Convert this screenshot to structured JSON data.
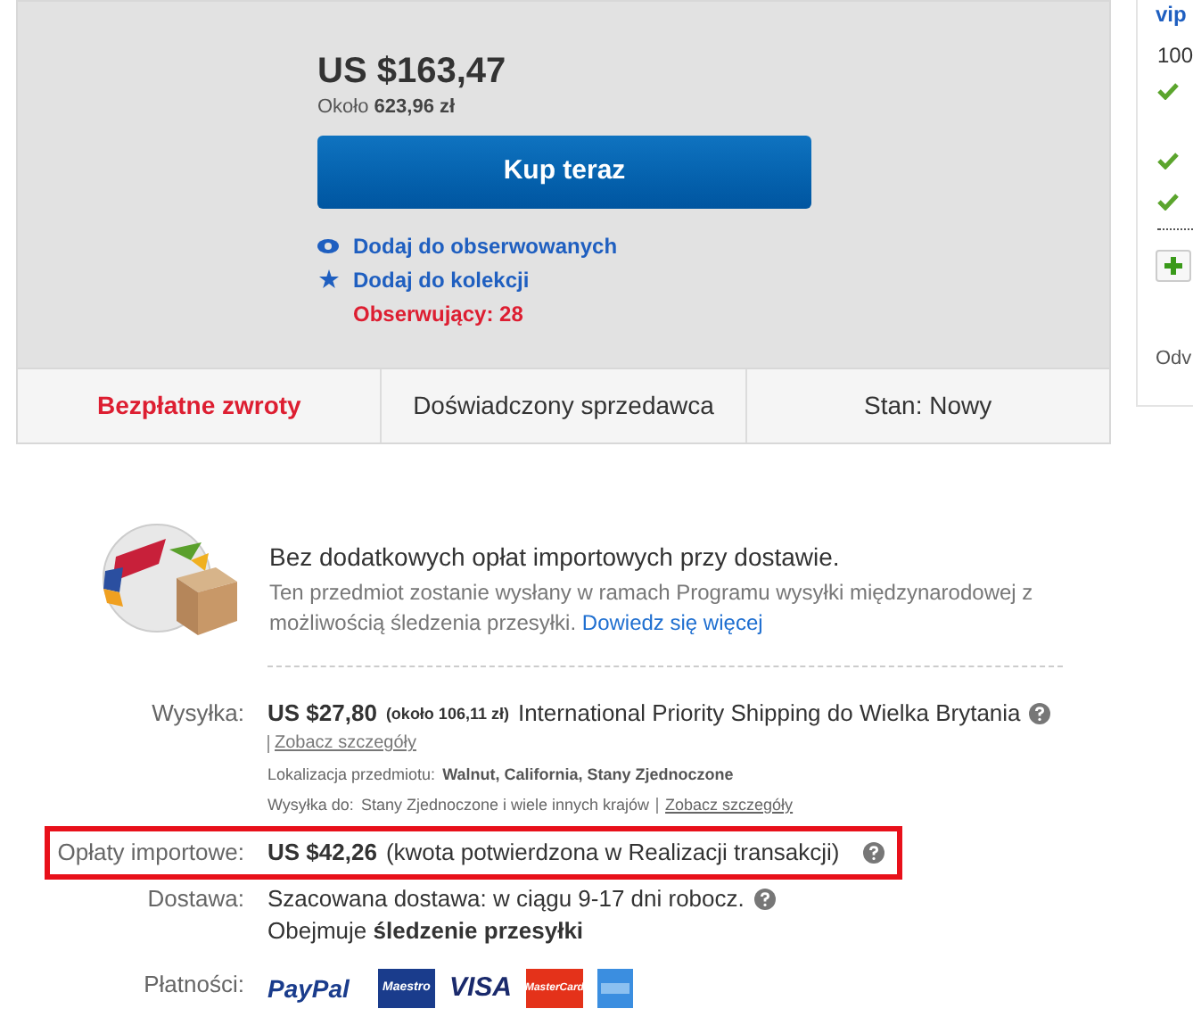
{
  "price": "US $163,47",
  "approx": {
    "prefix": "Około",
    "amount": "623,96 zł"
  },
  "buy_button": "Kup teraz",
  "actions": [
    {
      "kind": "watch",
      "label": "Dodaj do obserwowanych"
    },
    {
      "kind": "collection",
      "label": "Dodaj do kolekcji"
    }
  ],
  "watchers": "Obserwujący: 28",
  "features": [
    {
      "label": "Bezpłatne zwroty",
      "highlight": true
    },
    {
      "label": "Doświadczony sprzedawca",
      "highlight": false
    },
    {
      "label": "Stan: Nowy",
      "highlight": false
    }
  ],
  "side_panel": {
    "link": "vip",
    "count": "100",
    "item": "Odv"
  },
  "program": {
    "title": "Bez dodatkowych opłat importowych przy dostawie.",
    "text": "Ten przedmiot zostanie wysłany w ramach Programu wysyłki międzynarodowej z możliwością śledzenia przesyłki.",
    "link": "Dowiedz się więcej"
  },
  "shipping": {
    "label": "Wysyłka:",
    "price": "US $27,80",
    "approx": "(około 106,11 zł)",
    "service": "International Priority Shipping do Wielka Brytania",
    "details_link": "Zobacz szczegóły",
    "location_label": "Lokalizacja przedmiotu:",
    "location": "Walnut, California, Stany Zjednoczone",
    "ships_to_label": "Wysyłka do:",
    "ships_to": "Stany Zjednoczone i wiele innych krajów",
    "ships_to_link": "Zobacz szczegóły"
  },
  "import_fees": {
    "label": "Opłaty importowe:",
    "amount": "US $42,26",
    "note": "(kwota potwierdzona w Realizacji transakcji)",
    "highlighted": true
  },
  "delivery": {
    "label": "Dostawa:",
    "estimate": "Szacowana dostawa: w ciągu 9-17 dni robocz.",
    "tracking": "Obejmuje **śledzenie przesyłki**"
  },
  "payments": {
    "label": "Płatności:",
    "methods": [
      {
        "kind": "paypal",
        "text": "PayPal"
      },
      {
        "kind": "maestro",
        "text": "Maestro"
      },
      {
        "kind": "visa",
        "text": "VISA"
      },
      {
        "kind": "mastercard",
        "text": "MasterCard"
      },
      {
        "kind": "amex"
      }
    ]
  }
}
